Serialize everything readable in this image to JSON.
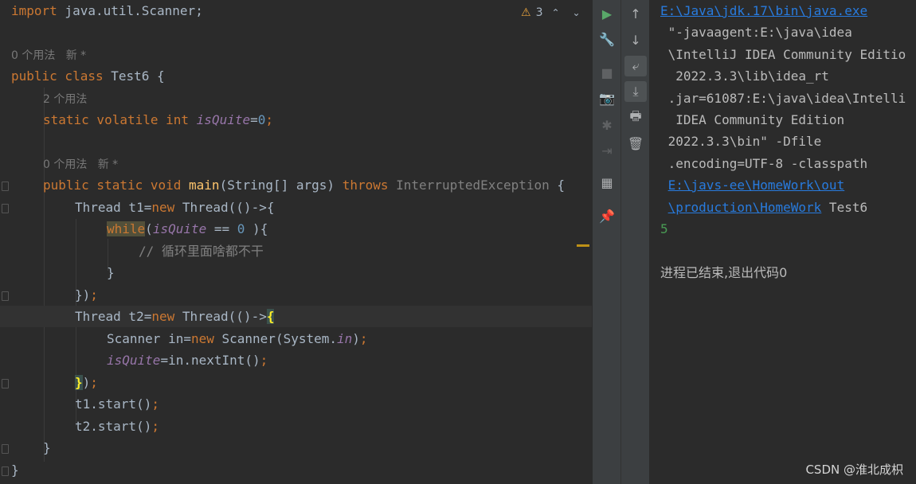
{
  "editor": {
    "lines": {
      "l1": {
        "kw": "import",
        "rest": " java.util.Scanner;"
      },
      "l3": {
        "hint": "0 个用法   新 *"
      },
      "l4": {
        "kw": "public class",
        "name": " Test6 {"
      },
      "l5": {
        "hint": "2 个用法"
      },
      "l6": {
        "kw": "static volatile int",
        "field": "isQuite",
        "eq": "=",
        "num": "0",
        "semi": ";"
      },
      "l8": {
        "hint": "0 个用法   新 *"
      },
      "l9": {
        "kw": "public static void",
        "fn": "main",
        "params": "(String[] args)",
        "throws": "throws",
        "exc": "InterruptedException",
        "brace": " {"
      },
      "l10": {
        "pre": "Thread t1=",
        "kw": "new",
        "post": " Thread(()->{"
      },
      "l11": {
        "kw": "while",
        "open": "(",
        "field": "isQuite",
        "op": " == ",
        "num": "0",
        "close": " ){"
      },
      "l12": {
        "comment": "// 循环里面啥都不干"
      },
      "l13": {
        "text": "}"
      },
      "l14": {
        "text": "})",
        "semi": ";"
      },
      "l15": {
        "pre": "Thread t2=",
        "kw": "new",
        "post": " Thread(()->",
        "brace": "{"
      },
      "l16": {
        "pre": "Scanner in=",
        "kw": "new",
        "post": " Scanner(System.",
        "field": "in",
        "close": ")",
        "semi": ";"
      },
      "l17": {
        "field": "isQuite",
        "post": "=in.nextInt()",
        "semi": ";"
      },
      "l18": {
        "brace": "}",
        "text": ")",
        "semi": ";"
      },
      "l19": {
        "text": "t1.start()",
        "semi": ";"
      },
      "l20": {
        "text": "t2.start()",
        "semi": ";"
      },
      "l21": {
        "text": "}"
      },
      "l22": {
        "text": "}"
      }
    },
    "inspection": {
      "warning_count": "3",
      "warn_icon": "⚠",
      "up": "⌃",
      "down": "⌄"
    }
  },
  "toolbar": {
    "rerun_icon": "▶",
    "settings_icon": "🔧",
    "stop_icon": "■",
    "dump_icon": "📷",
    "debug_icon": "✱",
    "login_icon": "⇥",
    "layout_icon": "▦",
    "pin_icon": "📌",
    "up_icon": "↑",
    "down_icon": "↓",
    "wrap_icon": "⤶",
    "scroll_end_icon": "⤓",
    "print_icon": "🖶",
    "trash_icon": "🗑"
  },
  "console": {
    "java_path": "E:\\Java\\jdk.17\\bin\\java.exe",
    "lines": [
      " \"-javaagent:E:\\java\\idea",
      " \\IntelliJ IDEA Community Editio",
      "  2022.3.3\\lib\\idea_rt",
      " .jar=61087:E:\\java\\idea\\Intelli",
      "  IDEA Community Edition",
      " 2022.3.3\\bin\" -Dfile",
      " .encoding=UTF-8 -classpath"
    ],
    "cp1": "E:\\javs-ee\\HomeWork\\out",
    "cp2": "\\production\\HomeWork",
    "main_class": " Test6",
    "input": "5",
    "exit": "进程已结束,退出代码0"
  },
  "watermark": "CSDN @淮北成枳"
}
